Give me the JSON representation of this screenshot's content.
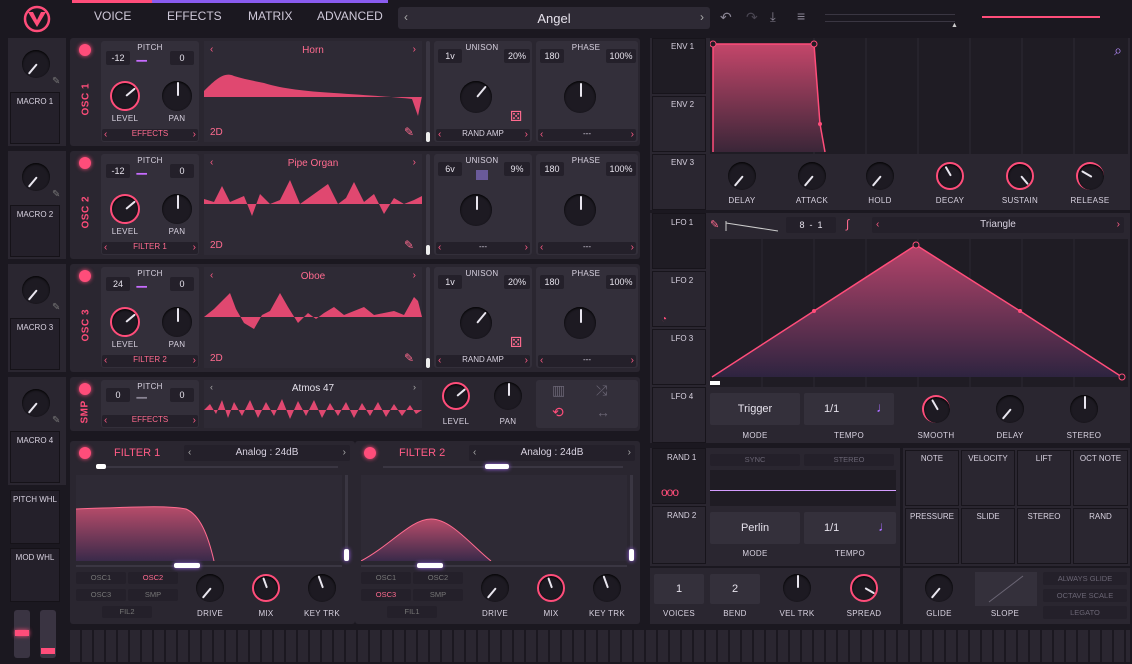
{
  "header": {
    "tabs": [
      "VOICE",
      "EFFECTS",
      "MATRIX",
      "ADVANCED"
    ],
    "preset": "Angel"
  },
  "macros": [
    "MACRO 1",
    "MACRO 2",
    "MACRO 3",
    "MACRO 4"
  ],
  "wheels": [
    "PITCH WHL",
    "MOD WHL"
  ],
  "osc": [
    {
      "label": "OSC 1",
      "pitch_label": "PITCH",
      "coarse": "-12",
      "fine": "0",
      "wave": "Horn",
      "level": "LEVEL",
      "pan": "PAN",
      "dest": "EFFECTS",
      "mode": "2D",
      "unison_label": "UNISON",
      "voices": "1v",
      "detune": "20%",
      "phase_label": "PHASE",
      "phase": "180",
      "phase_rand": "100%",
      "rand": "RAND AMP",
      "phase_dest": "---"
    },
    {
      "label": "OSC 2",
      "pitch_label": "PITCH",
      "coarse": "-12",
      "fine": "0",
      "wave": "Pipe Organ",
      "level": "LEVEL",
      "pan": "PAN",
      "dest": "FILTER 1",
      "mode": "2D",
      "unison_label": "UNISON",
      "voices": "6v",
      "detune": "9%",
      "phase_label": "PHASE",
      "phase": "180",
      "phase_rand": "100%",
      "rand": "---",
      "phase_dest": "---"
    },
    {
      "label": "OSC 3",
      "pitch_label": "PITCH",
      "coarse": "24",
      "fine": "0",
      "wave": "Oboe",
      "level": "LEVEL",
      "pan": "PAN",
      "dest": "FILTER 2",
      "mode": "2D",
      "unison_label": "UNISON",
      "voices": "1v",
      "detune": "20%",
      "phase_label": "PHASE",
      "phase": "180",
      "phase_rand": "100%",
      "rand": "RAND AMP",
      "phase_dest": "---"
    }
  ],
  "smp": {
    "label": "SMP",
    "pitch_label": "PITCH",
    "coarse": "0",
    "fine": "0",
    "name": "Atmos 47",
    "dest": "EFFECTS",
    "level": "LEVEL",
    "pan": "PAN"
  },
  "filters": [
    {
      "title": "FILTER 1",
      "model": "Analog : 24dB",
      "srcs": [
        "OSC1",
        "OSC2",
        "OSC3",
        "SMP"
      ],
      "route": "FIL2",
      "drive": "DRIVE",
      "mix": "MIX",
      "keytrk": "KEY TRK"
    },
    {
      "title": "FILTER 2",
      "model": "Analog : 24dB",
      "srcs": [
        "OSC1",
        "OSC2",
        "OSC3",
        "SMP"
      ],
      "route": "FIL1",
      "drive": "DRIVE",
      "mix": "MIX",
      "keytrk": "KEY TRK"
    }
  ],
  "env": {
    "tabs": [
      "ENV 1",
      "ENV 2",
      "ENV 3"
    ],
    "knobs": [
      "DELAY",
      "ATTACK",
      "HOLD",
      "DECAY",
      "SUSTAIN",
      "RELEASE"
    ]
  },
  "lfo": {
    "tabs": [
      "LFO 1",
      "LFO 2",
      "LFO 3",
      "LFO 4"
    ],
    "grid": "8",
    "sep": "-",
    "div": "1",
    "shape": "Triangle",
    "mode_val": "Trigger",
    "mode": "MODE",
    "tempo_val": "1/1",
    "tempo": "TEMPO",
    "knobs": [
      "SMOOTH",
      "DELAY",
      "STEREO"
    ]
  },
  "rand": {
    "tabs": [
      "RAND 1",
      "RAND 2"
    ],
    "sync": "SYNC",
    "stereo": "STEREO",
    "mode_val": "Perlin",
    "mode": "MODE",
    "tempo_val": "1/1",
    "tempo": "TEMPO"
  },
  "mod_sources": [
    "NOTE",
    "VELOCITY",
    "LIFT",
    "OCT NOTE",
    "PRESSURE",
    "SLIDE",
    "STEREO",
    "RAND"
  ],
  "voice": {
    "voices_val": "1",
    "voices": "VOICES",
    "bend_val": "2",
    "bend": "BEND",
    "veltrk": "VEL TRK",
    "spread": "SPREAD",
    "glide": "GLIDE",
    "slope": "SLOPE",
    "opts": [
      "ALWAYS GLIDE",
      "OCTAVE SCALE",
      "LEGATO"
    ]
  },
  "colors": {
    "accent": "#ff4d7a",
    "purple": "#a86cff",
    "bg": "#1b1820"
  }
}
